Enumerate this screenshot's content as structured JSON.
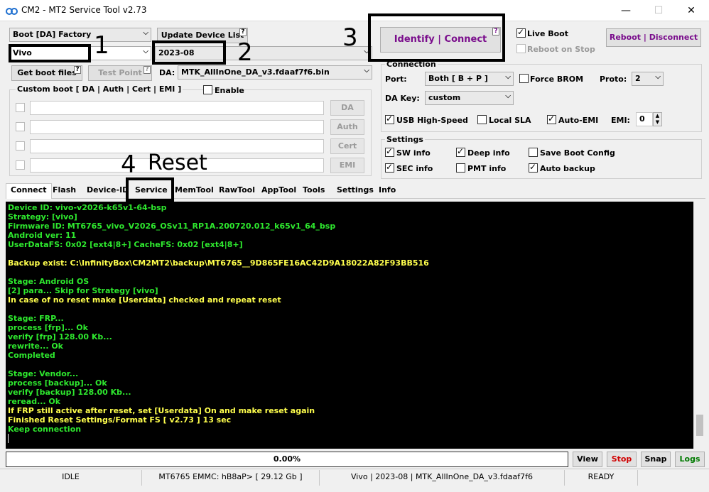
{
  "window": {
    "title": "CM2 - MT2 Service Tool v2.73",
    "min": "—",
    "max": "☐",
    "close": "✕"
  },
  "top": {
    "boot_combo": "Boot [DA] Factory",
    "update_btn": "Update Device List",
    "brand_combo": "Vivo",
    "date_combo": "2023-08",
    "get_boot_btn": "Get boot files",
    "test_point_btn": "Test Point",
    "da_label": "DA:",
    "da_combo": "MTK_AllInOne_DA_v3.fdaaf7f6.bin",
    "custom_boot_label": "Custom boot [ DA | Auth | Cert | EMI ]",
    "enable_label": "Enable",
    "side_buttons": [
      "DA",
      "Auth",
      "Cert",
      "EMI"
    ]
  },
  "identify_btn": "Identify | Connect",
  "qmark": "?",
  "live_boot": "Live Boot",
  "reboot_on_stop": "Reboot on Stop",
  "reboot_btn": "Reboot | Disconnect",
  "connection": {
    "title": "Connection",
    "port_label": "Port:",
    "port_value": "Both [ B + P ]",
    "force_brom": "Force BROM",
    "proto_label": "Proto:",
    "proto_value": "2",
    "da_key_label": "DA Key:",
    "da_key_value": "custom",
    "usb_hs": "USB High-Speed",
    "local_sla": "Local SLA",
    "auto_emi": "Auto-EMI",
    "emi_label": "EMI:",
    "emi_value": "0"
  },
  "settings": {
    "title": "Settings",
    "sw_info": "SW info",
    "deep_info": "Deep info",
    "save_boot_config": "Save Boot Config",
    "sec_info": "SEC info",
    "pmt_info": "PMT info",
    "auto_backup": "Auto backup"
  },
  "tabs": [
    "Connect",
    "Flash",
    "Device-ID",
    "Service",
    "MemTool",
    "RawTool",
    "AppTool",
    "Tools",
    "Settings",
    "Info"
  ],
  "log": [
    {
      "t": "Device ID: vivo-v2026-k65v1-64-bsp",
      "c": "g"
    },
    {
      "t": "Strategy: [vivo]",
      "c": "g"
    },
    {
      "t": "Firmware ID: MT6765_vivo_V2026_OSv11_RP1A.200720.012_k65v1_64_bsp",
      "c": "g"
    },
    {
      "t": "Android ver: 11",
      "c": "g"
    },
    {
      "t": "UserDataFS: 0x02 [ext4|8+] CacheFS: 0x02 [ext4|8+]",
      "c": "g"
    },
    {
      "t": "",
      "c": "g"
    },
    {
      "t": "Backup exist: C:\\InfinityBox\\CM2MT2\\backup\\MT6765__9D865FE16AC42D9A18022A82F93BB516",
      "c": "y"
    },
    {
      "t": "",
      "c": "g"
    },
    {
      "t": "Stage: Android OS",
      "c": "g"
    },
    {
      "t": "[2] para... Skip for Strategy [vivo]",
      "c": "g"
    },
    {
      "t": "In case of no reset make [Userdata] checked and repeat reset",
      "c": "y"
    },
    {
      "t": "",
      "c": "g"
    },
    {
      "t": "Stage: FRP...",
      "c": "g"
    },
    {
      "t": "process [frp]... Ok",
      "c": "g"
    },
    {
      "t": "verify [frp] 128.00 Kb...",
      "c": "g"
    },
    {
      "t": "rewrite... Ok",
      "c": "g"
    },
    {
      "t": "Completed",
      "c": "g"
    },
    {
      "t": "",
      "c": "g"
    },
    {
      "t": "Stage: Vendor...",
      "c": "g"
    },
    {
      "t": "process [backup]... Ok",
      "c": "g"
    },
    {
      "t": "verify [backup] 128.00 Kb...",
      "c": "g"
    },
    {
      "t": "reread... Ok",
      "c": "g"
    },
    {
      "t": "If FRP still active after reset, set [Userdata] On and make reset again",
      "c": "y"
    },
    {
      "t": "Finished Reset Settings/Format FS [ v2.73 ] 13 sec",
      "c": "y"
    },
    {
      "t": "Keep connection",
      "c": "g"
    }
  ],
  "progress": {
    "value": 0,
    "text": "0.00%"
  },
  "bottom_buttons": {
    "view": "View",
    "stop": "Stop",
    "snap": "Snap",
    "logs": "Logs"
  },
  "colors": {
    "stop": "#d00000",
    "logs": "#007a00",
    "identify": "#7a0d8c",
    "reboot": "#7a0d8c"
  },
  "status": {
    "state": "IDLE",
    "storage": "MT6765 EMMC: hB8aP>  [ 29.12 Gb ]",
    "info": "Vivo | 2023-08 | MTK_AllInOne_DA_v3.fdaaf7f6",
    "ready": "READY"
  },
  "annotations": {
    "a1": "1",
    "a2": "2",
    "a3": "3",
    "a4": "4",
    "a4_text": "Reset"
  }
}
